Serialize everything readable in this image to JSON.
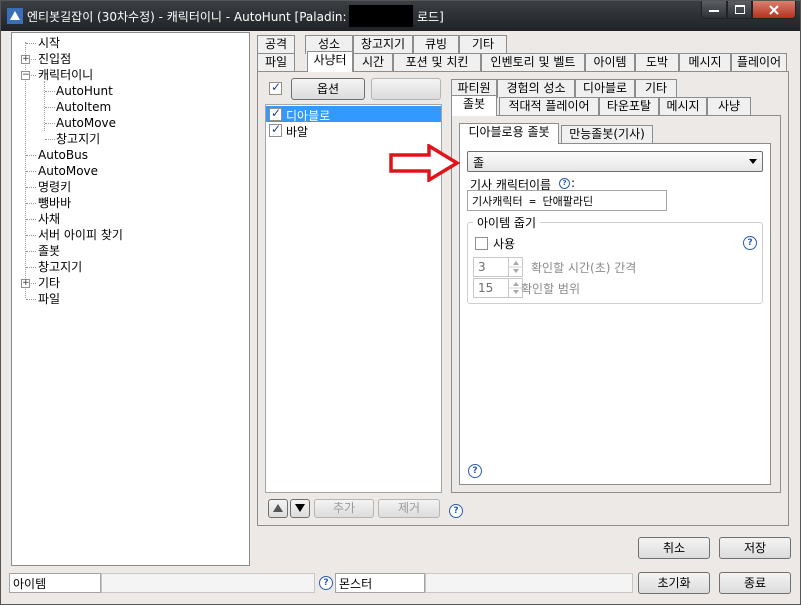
{
  "window": {
    "title": "엔티봇길잡이 (30차수정) - 캐릭터이니 - AutoHunt [Paladin:",
    "title_tail": "로드]"
  },
  "tree": {
    "items": [
      {
        "label": "시작",
        "indent": 0,
        "expander": ""
      },
      {
        "label": "진입점",
        "indent": 0,
        "expander": "+"
      },
      {
        "label": "캐릭터이니",
        "indent": 0,
        "expander": "−"
      },
      {
        "label": "AutoHunt",
        "indent": 1,
        "expander": ""
      },
      {
        "label": "AutoItem",
        "indent": 1,
        "expander": ""
      },
      {
        "label": "AutoMove",
        "indent": 1,
        "expander": ""
      },
      {
        "label": "창고지기",
        "indent": 1,
        "expander": ""
      },
      {
        "label": "AutoBus",
        "indent": 0,
        "expander": ""
      },
      {
        "label": "AutoMove",
        "indent": 0,
        "expander": ""
      },
      {
        "label": "명령키",
        "indent": 0,
        "expander": ""
      },
      {
        "label": "뺑바바",
        "indent": 0,
        "expander": ""
      },
      {
        "label": "사채",
        "indent": 0,
        "expander": ""
      },
      {
        "label": "서버 아이피 찾기",
        "indent": 0,
        "expander": ""
      },
      {
        "label": "졸봇",
        "indent": 0,
        "expander": ""
      },
      {
        "label": "창고지기",
        "indent": 0,
        "expander": ""
      },
      {
        "label": "기타",
        "indent": 0,
        "expander": "+"
      },
      {
        "label": "파일",
        "indent": 0,
        "expander": ""
      }
    ]
  },
  "main_tabs_row1": [
    "공격",
    "성소",
    "창고지기",
    "큐빙",
    "기타"
  ],
  "main_tabs_row2": [
    "파일",
    "사냥터",
    "시간",
    "포션 및 치킨",
    "인벤토리 및 벨트",
    "아이템",
    "도박",
    "메시지",
    "플레이어"
  ],
  "hunt": {
    "options_button": "옵션",
    "list": [
      {
        "label": "디아블로",
        "checked": true,
        "selected": true
      },
      {
        "label": "바알",
        "checked": true,
        "selected": false
      }
    ],
    "add_button": "추가",
    "remove_button": "제거"
  },
  "sub_tabs_row1": [
    "파티원",
    "경험의 성소",
    "디아블로",
    "기타"
  ],
  "sub_tabs_row2": [
    "졸봇",
    "적대적 플레이어",
    "타운포탈",
    "메시지",
    "사냥"
  ],
  "inner_tabs": [
    "디아블로용 졸봇",
    "만능졸봇(기사)"
  ],
  "dropdown": {
    "value": "졸"
  },
  "knight_name": {
    "label": "기사 캐릭터이름",
    "suffix": ":",
    "value": "기사캐릭터 = 단애팔라딘"
  },
  "item_pickup": {
    "group_label": "아이템 줍기",
    "use_label": "사용",
    "interval_value": "3",
    "interval_label": "확인할 시간(초) 간격",
    "range_value": "15",
    "range_label": "확인할 범위"
  },
  "buttons": {
    "cancel": "취소",
    "save": "저장",
    "reset": "초기화",
    "exit": "종료"
  },
  "status": {
    "item_label": "아이템",
    "monster_label": "몬스터"
  },
  "colors": {
    "selection": "#3399ff",
    "arrow": "#e0131b"
  }
}
